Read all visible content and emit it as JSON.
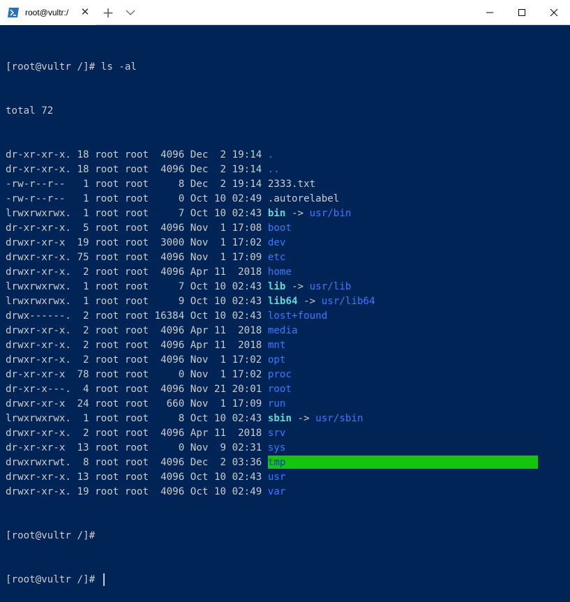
{
  "window": {
    "tab_title": "root@vultr:/",
    "tab_close": "✕",
    "new_tab": "+",
    "icon_names": {
      "tab": "powershell-icon",
      "close_tab": "close-icon",
      "new_tab": "plus-icon",
      "dropdown": "chevron-down-icon",
      "minimize": "minimize-icon",
      "maximize": "maximize-icon",
      "close": "close-icon"
    }
  },
  "colors": {
    "background": "#012456",
    "text": "#cccccc",
    "directory": "#3b78ff",
    "symlink": "#61d6d6",
    "sticky_dir_bg": "#13c60c",
    "sticky_dir_fg": "#0037da"
  },
  "terminal": {
    "command_line": "[root@vultr /]# ls -al",
    "total": "total 72",
    "entries": [
      {
        "meta": "dr-xr-xr-x. 18 root root  4096 Dec  2 19:14 ",
        "name": ".",
        "type": "dir"
      },
      {
        "meta": "dr-xr-xr-x. 18 root root  4096 Dec  2 19:14 ",
        "name": "..",
        "type": "dir"
      },
      {
        "meta": "-rw-r--r--   1 root root     8 Dec  2 19:14 ",
        "name": "2333.txt",
        "type": "file"
      },
      {
        "meta": "-rw-r--r--   1 root root     0 Oct 10 02:49 ",
        "name": ".autorelabel",
        "type": "file"
      },
      {
        "meta": "lrwxrwxrwx.  1 root root     7 Oct 10 02:43 ",
        "name": "bin",
        "type": "link",
        "arrow": " -> ",
        "target": "usr/bin"
      },
      {
        "meta": "dr-xr-xr-x.  5 root root  4096 Nov  1 17:08 ",
        "name": "boot",
        "type": "dir"
      },
      {
        "meta": "drwxr-xr-x  19 root root  3000 Nov  1 17:02 ",
        "name": "dev",
        "type": "dir"
      },
      {
        "meta": "drwxr-xr-x. 75 root root  4096 Nov  1 17:09 ",
        "name": "etc",
        "type": "dir"
      },
      {
        "meta": "drwxr-xr-x.  2 root root  4096 Apr 11  2018 ",
        "name": "home",
        "type": "dir"
      },
      {
        "meta": "lrwxrwxrwx.  1 root root     7 Oct 10 02:43 ",
        "name": "lib",
        "type": "link",
        "arrow": " -> ",
        "target": "usr/lib"
      },
      {
        "meta": "lrwxrwxrwx.  1 root root     9 Oct 10 02:43 ",
        "name": "lib64",
        "type": "link",
        "arrow": " -> ",
        "target": "usr/lib64"
      },
      {
        "meta": "drwx------.  2 root root 16384 Oct 10 02:43 ",
        "name": "lost+found",
        "type": "dir"
      },
      {
        "meta": "drwxr-xr-x.  2 root root  4096 Apr 11  2018 ",
        "name": "media",
        "type": "dir"
      },
      {
        "meta": "drwxr-xr-x.  2 root root  4096 Apr 11  2018 ",
        "name": "mnt",
        "type": "dir"
      },
      {
        "meta": "drwxr-xr-x.  2 root root  4096 Nov  1 17:02 ",
        "name": "opt",
        "type": "dir"
      },
      {
        "meta": "dr-xr-xr-x  78 root root     0 Nov  1 17:02 ",
        "name": "proc",
        "type": "dir"
      },
      {
        "meta": "dr-xr-x---.  4 root root  4096 Nov 21 20:01 ",
        "name": "root",
        "type": "dir"
      },
      {
        "meta": "drwxr-xr-x  24 root root   660 Nov  1 17:09 ",
        "name": "run",
        "type": "dir"
      },
      {
        "meta": "lrwxrwxrwx.  1 root root     8 Oct 10 02:43 ",
        "name": "sbin",
        "type": "link",
        "arrow": " -> ",
        "target": "usr/sbin"
      },
      {
        "meta": "drwxr-xr-x.  2 root root  4096 Apr 11  2018 ",
        "name": "srv",
        "type": "dir"
      },
      {
        "meta": "dr-xr-xr-x  13 root root     0 Nov  9 02:31 ",
        "name": "sys",
        "type": "dir"
      },
      {
        "meta": "drwxrwxrwt.  8 root root  4096 Dec  2 03:36 ",
        "name": "tmp",
        "type": "sticky"
      },
      {
        "meta": "drwxr-xr-x. 13 root root  4096 Oct 10 02:43 ",
        "name": "usr",
        "type": "dir"
      },
      {
        "meta": "drwxr-xr-x. 19 root root  4096 Oct 10 02:49 ",
        "name": "var",
        "type": "dir"
      }
    ],
    "prompts": [
      "[root@vultr /]#",
      "[root@vultr /]# "
    ]
  }
}
